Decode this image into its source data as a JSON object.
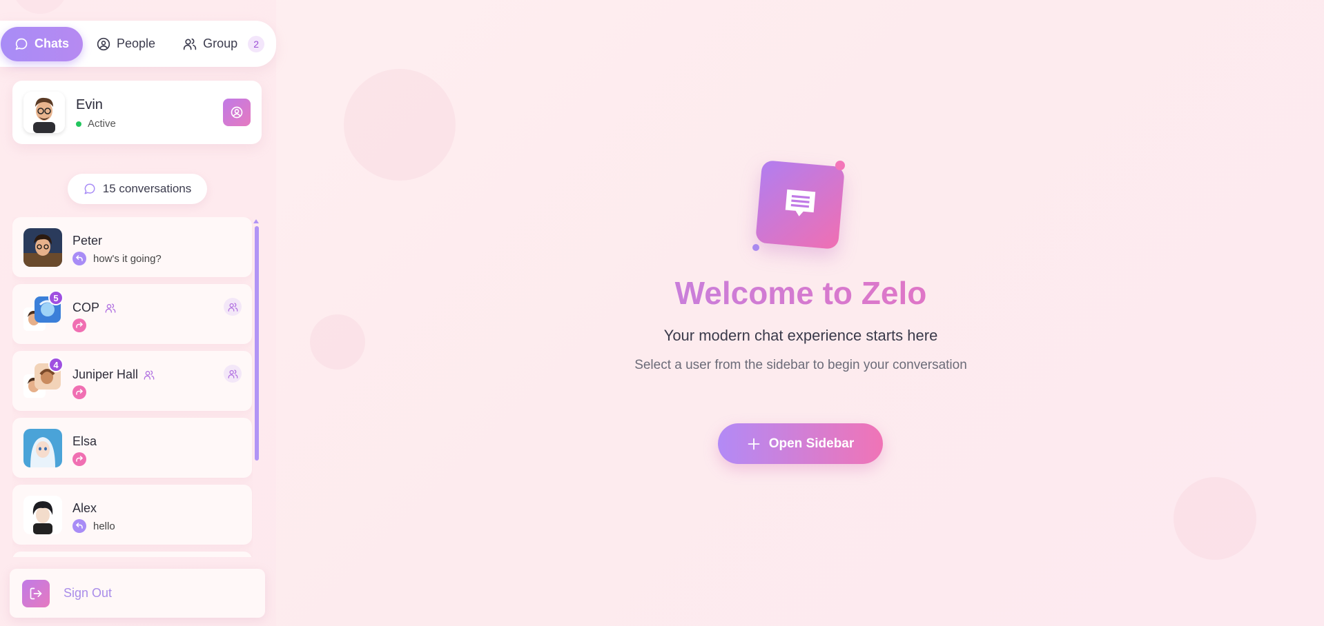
{
  "tabs": [
    {
      "label": "Chats",
      "icon": "chat-bubble-icon",
      "active": true
    },
    {
      "label": "People",
      "icon": "user-circle-icon",
      "active": false
    },
    {
      "label": "Group",
      "icon": "users-icon",
      "active": false,
      "badge": "2"
    }
  ],
  "profile": {
    "name": "Evin",
    "status": "Active"
  },
  "conversations_count": "15 conversations",
  "conversations": [
    {
      "name": "Peter",
      "preview": "how's it going?",
      "is_group": false
    },
    {
      "name": "COP",
      "preview": "",
      "is_group": true,
      "badge": "5"
    },
    {
      "name": "Juniper Hall",
      "preview": "",
      "is_group": true,
      "badge": "4"
    },
    {
      "name": "Elsa",
      "preview": "",
      "is_group": false
    },
    {
      "name": "Alex",
      "preview": "hello",
      "is_group": false
    }
  ],
  "signout_label": "Sign Out",
  "main": {
    "title": "Welcome to Zelo",
    "subtitle": "Your modern chat experience starts here",
    "hint": "Select a user from the sidebar to begin your conversation",
    "button_label": "Open Sidebar"
  },
  "colors": {
    "accent_purple": "#a88cf6",
    "accent_pink": "#f074b6",
    "status_green": "#22c55e",
    "badge_purple": "#9f4fe0"
  }
}
